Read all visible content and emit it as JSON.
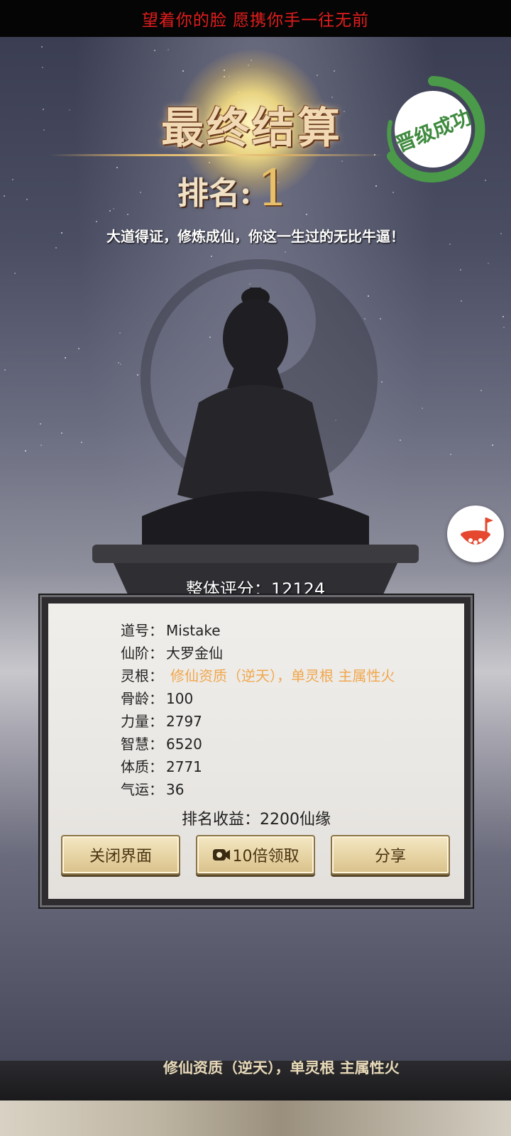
{
  "top_banner": {
    "text": "望着你的脸 愿携你手一往无前"
  },
  "header": {
    "title": "最终结算",
    "rank_label": "排名:",
    "rank_value": "1",
    "slogan": "大道得证，修炼成仙，你这一生过的无比牛逼！",
    "stamp_text": "晋级成功"
  },
  "score": {
    "label": "整体评分：",
    "value": "12124"
  },
  "stats": [
    {
      "key": "道号：",
      "value": "Mistake",
      "accent": false
    },
    {
      "key": "仙阶：",
      "value": "大罗金仙",
      "accent": false
    },
    {
      "key": "灵根：",
      "value": "修仙资质（逆天），单灵根 主属性火",
      "accent": true
    },
    {
      "key": "骨龄：",
      "value": "100",
      "accent": false
    },
    {
      "key": "力量：",
      "value": "2797",
      "accent": false
    },
    {
      "key": "智慧：",
      "value": "6520",
      "accent": false
    },
    {
      "key": "体质：",
      "value": "2771",
      "accent": false
    },
    {
      "key": "气运：",
      "value": "36",
      "accent": false
    }
  ],
  "income": {
    "label": "排名收益：",
    "value": "2200仙缘"
  },
  "buttons": {
    "close": "关闭界面",
    "tenx": "10倍领取",
    "share": "分享"
  },
  "bottom_strip": {
    "text": "修仙资质（逆天），单灵根 主属性火"
  },
  "colors": {
    "banner_text": "#e21d1d",
    "accent_text": "#f0a74d",
    "stamp_green": "#4a9a4a",
    "side_button_red": "#e5482f"
  },
  "icons": {
    "side_button": "fruit-flag-icon",
    "video": "video-camera-icon"
  }
}
